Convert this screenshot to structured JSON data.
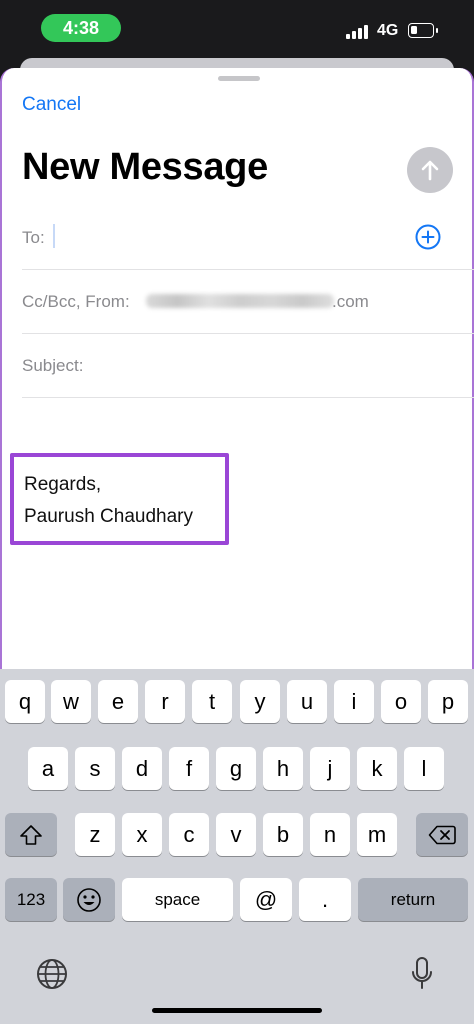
{
  "status_bar": {
    "time": "4:38",
    "network": "4G",
    "battery_level": 0.3
  },
  "compose": {
    "cancel_label": "Cancel",
    "title": "New Message",
    "to_label": "To:",
    "cc_label": "Cc/Bcc, From:",
    "from_email_domain": ".com",
    "subject_label": "Subject:",
    "signature_line1": "Regards,",
    "signature_line2": "Paurush Chaudhary"
  },
  "keyboard": {
    "row1": [
      "q",
      "w",
      "e",
      "r",
      "t",
      "y",
      "u",
      "i",
      "o",
      "p"
    ],
    "row2": [
      "a",
      "s",
      "d",
      "f",
      "g",
      "h",
      "j",
      "k",
      "l"
    ],
    "row3": [
      "z",
      "x",
      "c",
      "v",
      "b",
      "n",
      "m"
    ],
    "numbers_label": "123",
    "space_label": "space",
    "at_label": "@",
    "period_label": ".",
    "return_label": "return"
  },
  "colors": {
    "accent": "#1477f5",
    "highlight_border": "#9a46d6",
    "time_pill": "#33c759",
    "send_button": "#c7c7cc"
  },
  "icons": [
    "send-arrow-icon",
    "add-contact-icon",
    "shift-icon",
    "delete-icon",
    "emoji-icon",
    "globe-icon",
    "microphone-icon"
  ]
}
